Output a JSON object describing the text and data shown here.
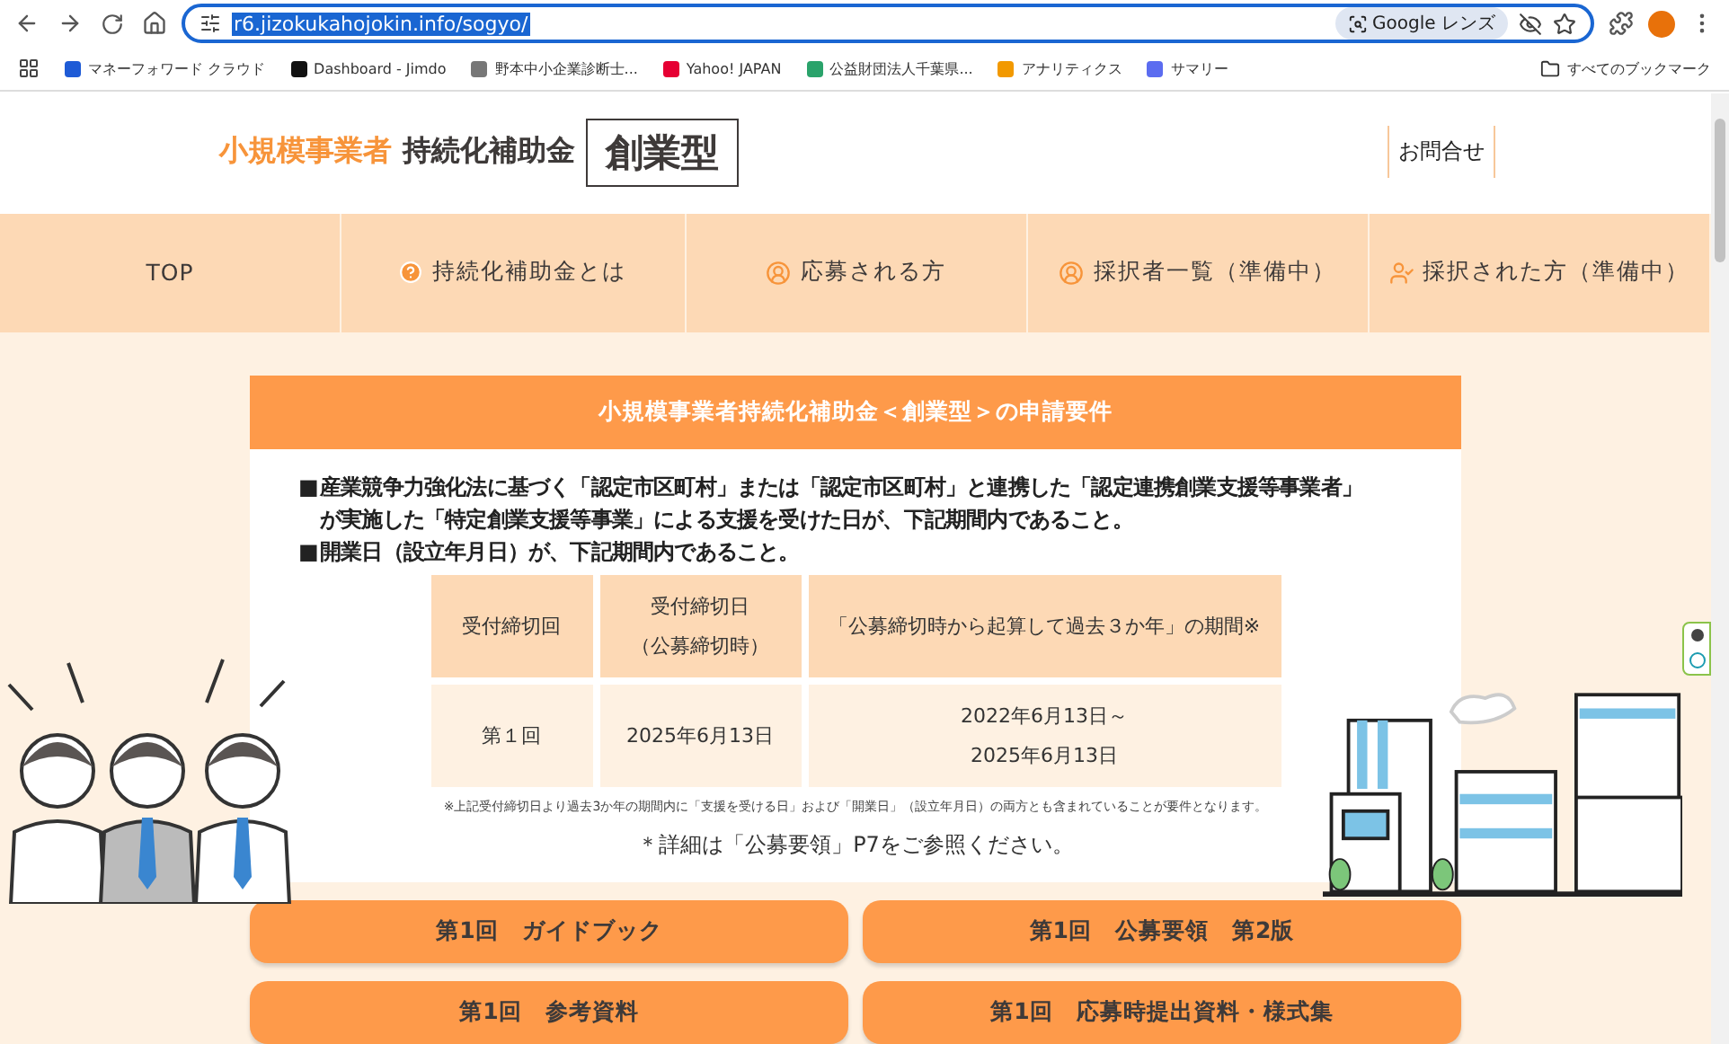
{
  "browser": {
    "url": {
      "text": "r6.jizokukahojokin.info/sogyo/",
      "selected": true
    },
    "lens_label": "Google レンズ",
    "bookmarks": [
      {
        "label": "マネーフォワード クラウド"
      },
      {
        "label": "Dashboard - Jimdo"
      },
      {
        "label": "野本中小企業診断士..."
      },
      {
        "label": "Yahoo! JAPAN"
      },
      {
        "label": "公益財団法人千葉県..."
      },
      {
        "label": "アナリティクス"
      },
      {
        "label": "サマリー"
      }
    ],
    "all_bookmarks": "すべてのブックマーク"
  },
  "header": {
    "logo_accent": "小規模事業者",
    "logo_main": "持続化補助金",
    "logo_badge": "創業型",
    "contact": "お問合せ"
  },
  "nav": [
    {
      "label": "TOP",
      "kind": "plain"
    },
    {
      "label": "持続化補助金とは",
      "kind": "help"
    },
    {
      "label": "応募される方",
      "kind": "person"
    },
    {
      "label": "採択者一覧（準備中）",
      "kind": "person"
    },
    {
      "label": "採択された方（準備中）",
      "kind": "person-check"
    }
  ],
  "card": {
    "title": "小規模事業者持続化補助金＜創業型＞の申請要件",
    "bullets": [
      {
        "marker": "■",
        "text": "産業競争力強化法に基づく「認定市区町村」または「認定市区町村」と連携した「認定連携創業支援等事業者」が実施した「特定創業支援等事業」による支援を受けた日が、下記期間内であること。"
      },
      {
        "marker": "■",
        "text": "開業日（設立年月日）が、下記期間内であること。"
      }
    ],
    "table": {
      "columns": [
        "受付締切回",
        "受付締切日（公募締切時）",
        "「公募締切時から起算して過去３か年」の期間※"
      ],
      "rows": [
        [
          "第１回",
          "2025年6月13日",
          "2022年6月13日～2025年6月13日"
        ]
      ]
    },
    "note": "※上記受付締切日より過去3か年の期間内に「支援を受ける日」および「開業日」（設立年月日）の両方とも含まれていることが要件となります。",
    "detail": "＊詳細は「公募要領」P7をご参照ください。"
  },
  "buttons": [
    "第1回　ガイドブック",
    "第1回　公募要領　第2版",
    "第1回　参考資料",
    "第1回　応募時提出資料・様式集"
  ]
}
